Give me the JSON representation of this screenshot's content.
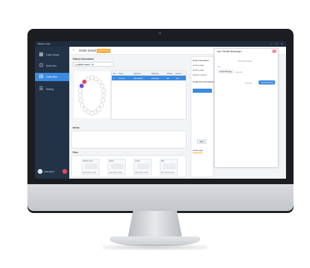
{
  "window": {
    "app_title": "MaxIt Link",
    "controls": "– □ ×"
  },
  "sidebar": {
    "items": [
      {
        "label": "Case Board",
        "icon": "grid-icon"
      },
      {
        "label": "Work Box",
        "icon": "inbox-icon"
      },
      {
        "label": "Order Box",
        "icon": "order-icon"
      },
      {
        "label": "Setting",
        "icon": "settings-icon"
      }
    ],
    "active_index": 2,
    "user": {
      "name": "username"
    }
  },
  "header": {
    "back": "‹",
    "title": "Order Detail",
    "status": "DRAFTING"
  },
  "patient": {
    "section": "Patient Information",
    "chip": "◎ patient name / id"
  },
  "order_table": {
    "headers": [
      "No.",
      "Type",
      "Method",
      "Material",
      "Shade",
      "Pontic"
    ],
    "row": [
      "1",
      "Crown",
      "Monolithic",
      "Zirconia",
      "A2",
      "Yes"
    ]
  },
  "memo": {
    "label": "Memo"
  },
  "files": {
    "label": "Files",
    "cards": [
      {
        "name": "Patient scan",
        "date": "2017-05-01 12:30"
      },
      {
        "name": "Upper",
        "date": "2017-05-01 12:30"
      },
      {
        "name": "Lower",
        "date": "2017-05-01 12:30"
      },
      {
        "name": "Bite",
        "date": "2017-05-01 12:30"
      }
    ]
  },
  "order_info": {
    "section": "Order Information",
    "fields": [
      "Ordered date",
      "Delivery date",
      "Delivery method"
    ],
    "prod_label": "Production Information",
    "status_label": "All Product",
    "button": "Save"
  },
  "chat": {
    "title": "Lab / Dental Messenger",
    "date": "2017-05-01 Mon",
    "incoming": "Good Morning",
    "incoming_time": "09:20 AM",
    "outgoing": "Good Morning",
    "outgoing_time": "09:22 AM",
    "sender": "Lab"
  },
  "colors": {
    "sidebar": "#233347",
    "accent": "#3b8be0",
    "badge": "#f5a623",
    "logout": "#e2465a",
    "chat_close": "#ff8fb0"
  }
}
